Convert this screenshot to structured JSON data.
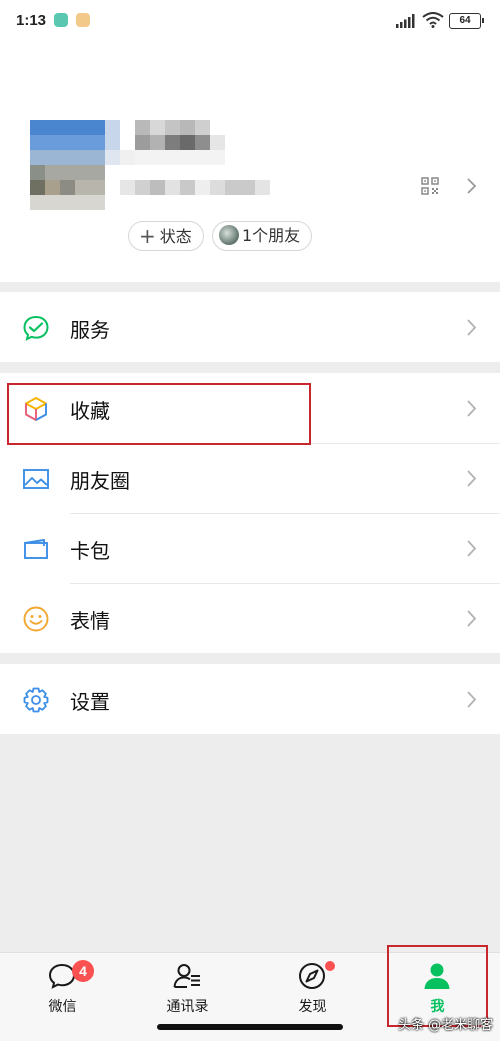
{
  "status_bar": {
    "time": "1:13",
    "battery": "64"
  },
  "profile": {
    "status_pill": "状态",
    "friends_pill": "1个朋友"
  },
  "menu": {
    "services": "服务",
    "favorites": "收藏",
    "moments": "朋友圈",
    "cards": "卡包",
    "stickers": "表情",
    "settings": "设置"
  },
  "tabbar": {
    "tabs": [
      {
        "label": "微信",
        "badge": "4"
      },
      {
        "label": "通讯录"
      },
      {
        "label": "发现"
      },
      {
        "label": "我"
      }
    ],
    "active_color": "#07c160"
  },
  "watermark": "头条 @老米聊客",
  "colors": {
    "accent": "#07c160",
    "highlight": "#c8282d",
    "badge": "#fa5151"
  }
}
